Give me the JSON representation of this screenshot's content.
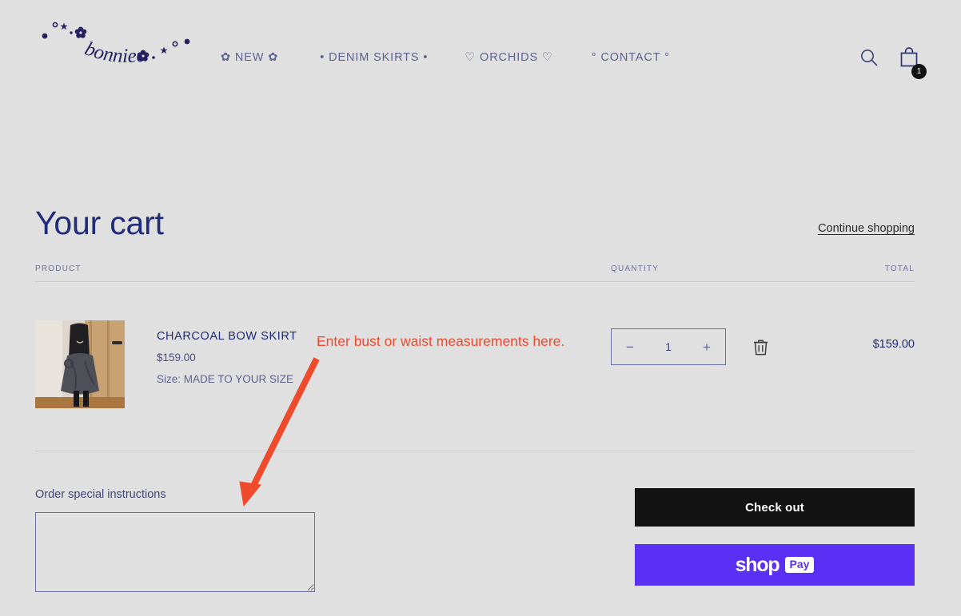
{
  "site": {
    "logo_text": "bonniee",
    "logo_color": "#272060",
    "background_color": "#e0e0e0"
  },
  "header": {
    "nav": [
      {
        "label": "✿ NEW ✿",
        "name": "nav-new"
      },
      {
        "label": "• DENIM SKIRTS •",
        "name": "nav-denim-skirts"
      },
      {
        "label": "♡ ORCHIDS ♡",
        "name": "nav-orchids"
      },
      {
        "label": "° CONTACT °",
        "name": "nav-contact"
      }
    ],
    "search_icon": "search-icon",
    "cart_icon": "shopping-bag-icon",
    "cart_count": "1"
  },
  "cart": {
    "title": "Your cart",
    "continue_shopping": "Continue shopping",
    "columns": {
      "product": "PRODUCT",
      "quantity": "QUANTITY",
      "total": "TOTAL"
    },
    "items": [
      {
        "title": "CHARCOAL BOW SKIRT",
        "price": "$159.00",
        "variant": "Size: MADE TO YOUR SIZE",
        "quantity": "1",
        "line_total": "$159.00",
        "decrease_label": "−",
        "increase_label": "+",
        "remove_icon": "trash-icon",
        "image_alt": "model wearing charcoal bow skirt"
      }
    ],
    "notes_label": "Order special instructions",
    "notes_value": "",
    "notes_placeholder": ""
  },
  "checkout": {
    "checkout_label": "Check out",
    "shop_pay_word": "shop",
    "shop_pay_pill": "Pay",
    "shop_pay_color": "#5a31f4",
    "checkout_bg": "#121212"
  },
  "annotation": {
    "text": "Enter bust or waist measurements here.",
    "color": "#f04a2d",
    "arrow": "red-arrow-pointing-to-notes-field"
  }
}
